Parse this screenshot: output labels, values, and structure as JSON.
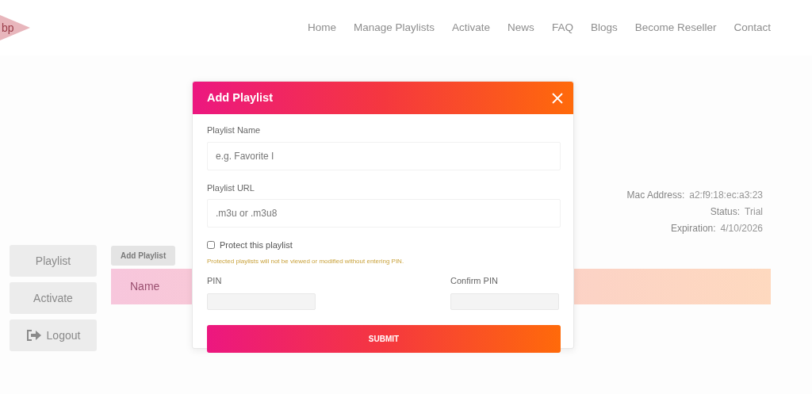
{
  "logo": {
    "text": "bp"
  },
  "nav": [
    {
      "label": "Home"
    },
    {
      "label": "Manage Playlists"
    },
    {
      "label": "Activate"
    },
    {
      "label": "News"
    },
    {
      "label": "FAQ"
    },
    {
      "label": "Blogs"
    },
    {
      "label": "Become Reseller"
    },
    {
      "label": "Contact"
    }
  ],
  "sidebar": [
    {
      "label": "Playlist",
      "kind": "plain"
    },
    {
      "label": "Activate",
      "kind": "plain"
    },
    {
      "label": "Logout",
      "kind": "logout"
    }
  ],
  "device_info": [
    {
      "label": "Mac Address:",
      "value": "a2:f9:18:ec:a3:23"
    },
    {
      "label": "Status:",
      "value": "Trial"
    },
    {
      "label": "Expiration:",
      "value": "4/10/2026"
    }
  ],
  "toolbar": [
    {
      "label": "Add Playlist"
    }
  ],
  "table": {
    "columns": [
      "Name"
    ]
  },
  "modal": {
    "title": "Add Playlist",
    "fields": [
      {
        "label": "Playlist Name",
        "placeholder": "e.g. Favorite I"
      },
      {
        "label": "Playlist URL",
        "placeholder": ".m3u or .m3u8"
      }
    ],
    "protect": {
      "label": "Protect this playlist",
      "checked": false
    },
    "hint": "Protected playlists will not be viewed or modified without entering PIN.",
    "pins": [
      {
        "label": "PIN"
      },
      {
        "label": "Confirm PIN"
      }
    ],
    "submit": "SUBMIT"
  }
}
